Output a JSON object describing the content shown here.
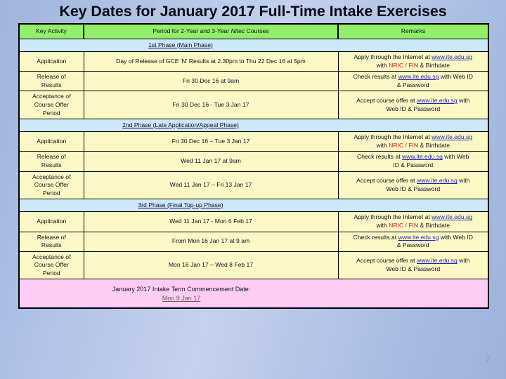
{
  "title": "Key Dates for January 2017 Full-Time Intake Exercises",
  "colors": {
    "header_green": "#92ee6b",
    "phase_blue": "#cee8fb",
    "body_yellow": "#fbf8c5",
    "footer_pink": "#ffccf6",
    "link_blue": "#2222bb",
    "accent_red": "#d81b1b",
    "background": "#a9bde2"
  },
  "table": {
    "headers": [
      "Key Activity",
      "Period for 2-Year and 3-Year ",
      "Nitec",
      " Courses",
      "Remarks"
    ],
    "header_activity": "Key Activity",
    "header_period_pre": "Period for 2-Year and 3-Year ",
    "header_period_italic": "Nitec",
    "header_period_post": " Courses",
    "header_remarks": "Remarks",
    "phases": [
      {
        "label": "1st Phase (Main Phase)",
        "rows": [
          {
            "activity": "Application",
            "period": "Day of Release of  GCE 'N' Results  at 2.30pm to Thu 22 Dec 16 at 5pm",
            "remarks_parts": [
              {
                "text": "Apply through the Internet at ",
                "style": "plain"
              },
              {
                "text": "www.ite.edu.sg",
                "style": "link"
              },
              {
                "text": "\nwith ",
                "style": "plain"
              },
              {
                "text": "NRIC / FIN",
                "style": "red"
              },
              {
                "text": " & Birthdate",
                "style": "plain"
              }
            ]
          },
          {
            "activity": "Release of\nResults",
            "period": "Fri 30 Dec 16 at 9am",
            "remarks_parts": [
              {
                "text": "Check results at ",
                "style": "plain"
              },
              {
                "text": "www.ite.edu.sg",
                "style": "link"
              },
              {
                "text": " with Web ID\n& Password",
                "style": "plain"
              }
            ]
          },
          {
            "activity": "Acceptance of\nCourse Offer\nPeriod",
            "period": "Fri 30 Dec 16 - Tue 3 Jan  17",
            "remarks_parts": [
              {
                "text": "Accept course offer at ",
                "style": "plain"
              },
              {
                "text": "www.ite.edu.sg",
                "style": "link"
              },
              {
                "text": " with\nWeb ID & Password",
                "style": "plain"
              }
            ]
          }
        ]
      },
      {
        "label": "2nd Phase (Late Application/Appeal Phase)",
        "rows": [
          {
            "activity": "Application",
            "period": "Fri 30 Dec 16 – Tue 3 Jan 17",
            "remarks_parts": [
              {
                "text": "Apply through the Internet at ",
                "style": "plain"
              },
              {
                "text": "www.ite.edu.sg",
                "style": "link"
              },
              {
                "text": "\nwith ",
                "style": "plain"
              },
              {
                "text": "NRIC / FIN",
                "style": "red"
              },
              {
                "text": "  & Birthdate",
                "style": "plain"
              }
            ]
          },
          {
            "activity": "Release of\nResults",
            "period": "Wed 11 Jan 17 at 9am",
            "remarks_parts": [
              {
                "text": "Check results at ",
                "style": "plain"
              },
              {
                "text": "www.ite.edu.sg",
                "style": "link"
              },
              {
                "text": "  with Web\nID & Password",
                "style": "plain"
              }
            ]
          },
          {
            "activity": "Acceptance of\nCourse Offer\nPeriod",
            "period": "Wed 11 Jan 17 – Fri 13 Jan 17",
            "remarks_parts": [
              {
                "text": "Accept course offer at ",
                "style": "plain"
              },
              {
                "text": "www.ite.edu.sg",
                "style": "link"
              },
              {
                "text": " with\nWeb ID & Password",
                "style": "plain"
              }
            ]
          }
        ]
      },
      {
        "label": "3rd Phase (Final Top-up Phase)",
        "rows": [
          {
            "activity": "Application",
            "period": "Wed 11 Jan 17 -  Mon 6 Feb  17",
            "remarks_parts": [
              {
                "text": "Apply through the Internet at ",
                "style": "plain"
              },
              {
                "text": "www.ite.edu.sg",
                "style": "link"
              },
              {
                "text": "\nwith ",
                "style": "plain"
              },
              {
                "text": "NRIC / FIN",
                "style": "red"
              },
              {
                "text": "  & Birthdate",
                "style": "plain"
              }
            ]
          },
          {
            "activity": "Release of\nResults",
            "period": "From Mon 16 Jan 17 at 9 am",
            "remarks_parts": [
              {
                "text": "Check results at ",
                "style": "plain"
              },
              {
                "text": "www.ite.edu.sg",
                "style": "link"
              },
              {
                "text": " with Web ID\n& Password",
                "style": "plain"
              }
            ]
          },
          {
            "activity": "Acceptance of\nCourse Offer\nPeriod",
            "period": "Mon 16 Jan 17 – Wed 8 Feb 17",
            "remarks_parts": [
              {
                "text": "Accept course offer at ",
                "style": "plain"
              },
              {
                "text": "www.ite.edu.sg",
                "style": "link"
              },
              {
                "text": " with\nWeb ID & Password",
                "style": "plain"
              }
            ]
          }
        ]
      }
    ],
    "footer": {
      "line1": "January 2017 Intake Term Commencement Date:",
      "line2": "Mon 9 Jan 17"
    }
  },
  "page_number": "2"
}
